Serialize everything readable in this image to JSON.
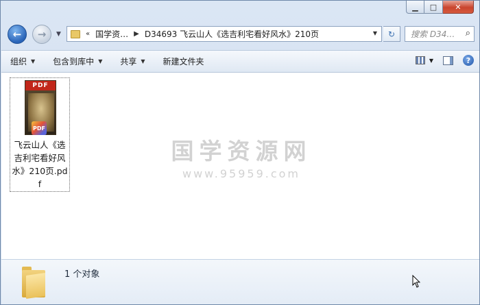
{
  "window": {
    "minimize_glyph": "▁",
    "maximize_glyph": "□",
    "close_glyph": "✕"
  },
  "nav": {
    "back_glyph": "←",
    "forward_glyph": "→",
    "history_glyph": "▼"
  },
  "address": {
    "overflow": "«",
    "crumbs": [
      "国学资…",
      "D34693 飞云山人《选吉利宅看好风水》210页"
    ],
    "separator": "▶",
    "dropdown_glyph": "▼",
    "refresh_glyph": "↻"
  },
  "search": {
    "placeholder": "搜索 D34…",
    "icon_glyph": "⌕"
  },
  "toolbar": {
    "organize": "组织",
    "include_in_library": "包含到库中",
    "share": "共享",
    "new_folder": "新建文件夹",
    "menu_arrow": "▼",
    "help_glyph": "?"
  },
  "files": [
    {
      "name": "飞云山人《选吉利宅看好风水》210页.pdf",
      "type": "pdf",
      "thumb_band": "PDF",
      "badge": "PDF",
      "selected": true
    }
  ],
  "watermark": {
    "title": "国学资源网",
    "url": "www.95959.com"
  },
  "status": {
    "object_count": "1 个对象"
  },
  "colors": {
    "chrome": "#dbe6f4",
    "close_button": "#c9452e",
    "folder": "#e9c867",
    "pdf_red": "#c1271a"
  }
}
